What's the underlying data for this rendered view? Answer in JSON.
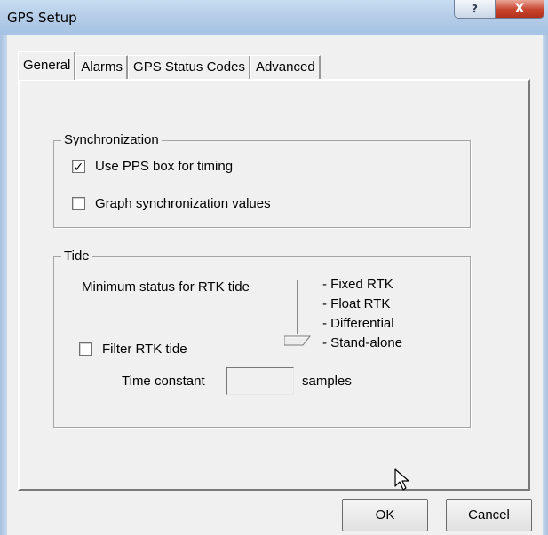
{
  "window": {
    "title": "GPS Setup",
    "help_glyph": "?",
    "close_glyph": "X"
  },
  "tabs": [
    {
      "label": "General",
      "active": true
    },
    {
      "label": "Alarms",
      "active": false
    },
    {
      "label": "GPS Status Codes",
      "active": false
    },
    {
      "label": "Advanced",
      "active": false
    }
  ],
  "synchronization": {
    "legend": "Synchronization",
    "use_pps": {
      "label": "Use PPS box for timing",
      "checked": true,
      "mark": "✓"
    },
    "graph_sync": {
      "label": "Graph synchronization values",
      "checked": false
    }
  },
  "tide": {
    "legend": "Tide",
    "min_status_label": "Minimum status for RTK tide",
    "rtk_levels": [
      "- Fixed RTK",
      "- Float RTK",
      "- Differential",
      "- Stand-alone"
    ],
    "selected_level": "- Stand-alone",
    "filter_rtk": {
      "label": "Filter RTK tide",
      "checked": false
    },
    "time_constant_label": "Time constant",
    "time_constant_value": "",
    "samples_label": "samples"
  },
  "buttons": {
    "ok": "OK",
    "cancel": "Cancel"
  }
}
